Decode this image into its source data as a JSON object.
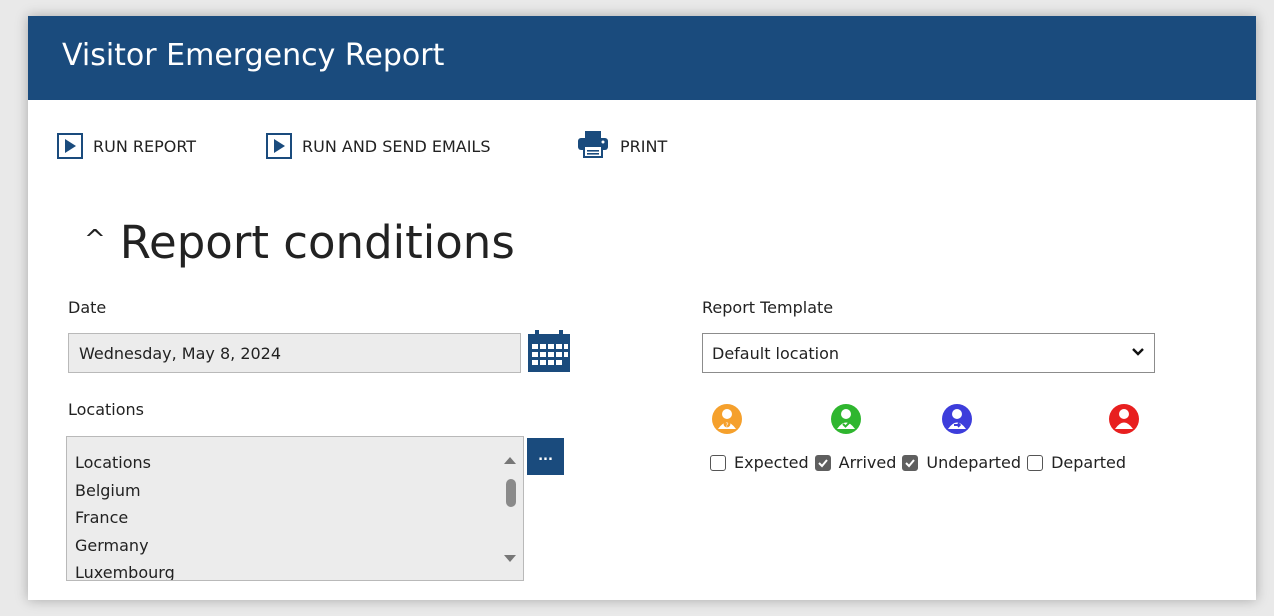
{
  "window": {
    "title": "Visitor Emergency Report"
  },
  "toolbar": {
    "run_report": "RUN REPORT",
    "run_send": "RUN AND SEND EMAILS",
    "print": "PRINT"
  },
  "section": {
    "caret": "^",
    "title": "Report conditions"
  },
  "date": {
    "label": "Date",
    "value": "Wednesday, May 8, 2024"
  },
  "locations": {
    "label": "Locations",
    "items": [
      "Locations",
      "Belgium",
      "France",
      "Germany",
      "Luxembourg"
    ]
  },
  "dots_label": "...",
  "template": {
    "label": "Report Template",
    "selected": "Default location"
  },
  "statuses": [
    {
      "label": "Expected",
      "checked": false,
      "color": "#f5a02c"
    },
    {
      "label": "Arrived",
      "checked": true,
      "color": "#2fb62f"
    },
    {
      "label": "Undeparted",
      "checked": true,
      "color": "#3d3ddb"
    },
    {
      "label": "Departed",
      "checked": false,
      "color": "#e81f1f"
    }
  ],
  "colors": {
    "brand": "#1a4b7d"
  }
}
